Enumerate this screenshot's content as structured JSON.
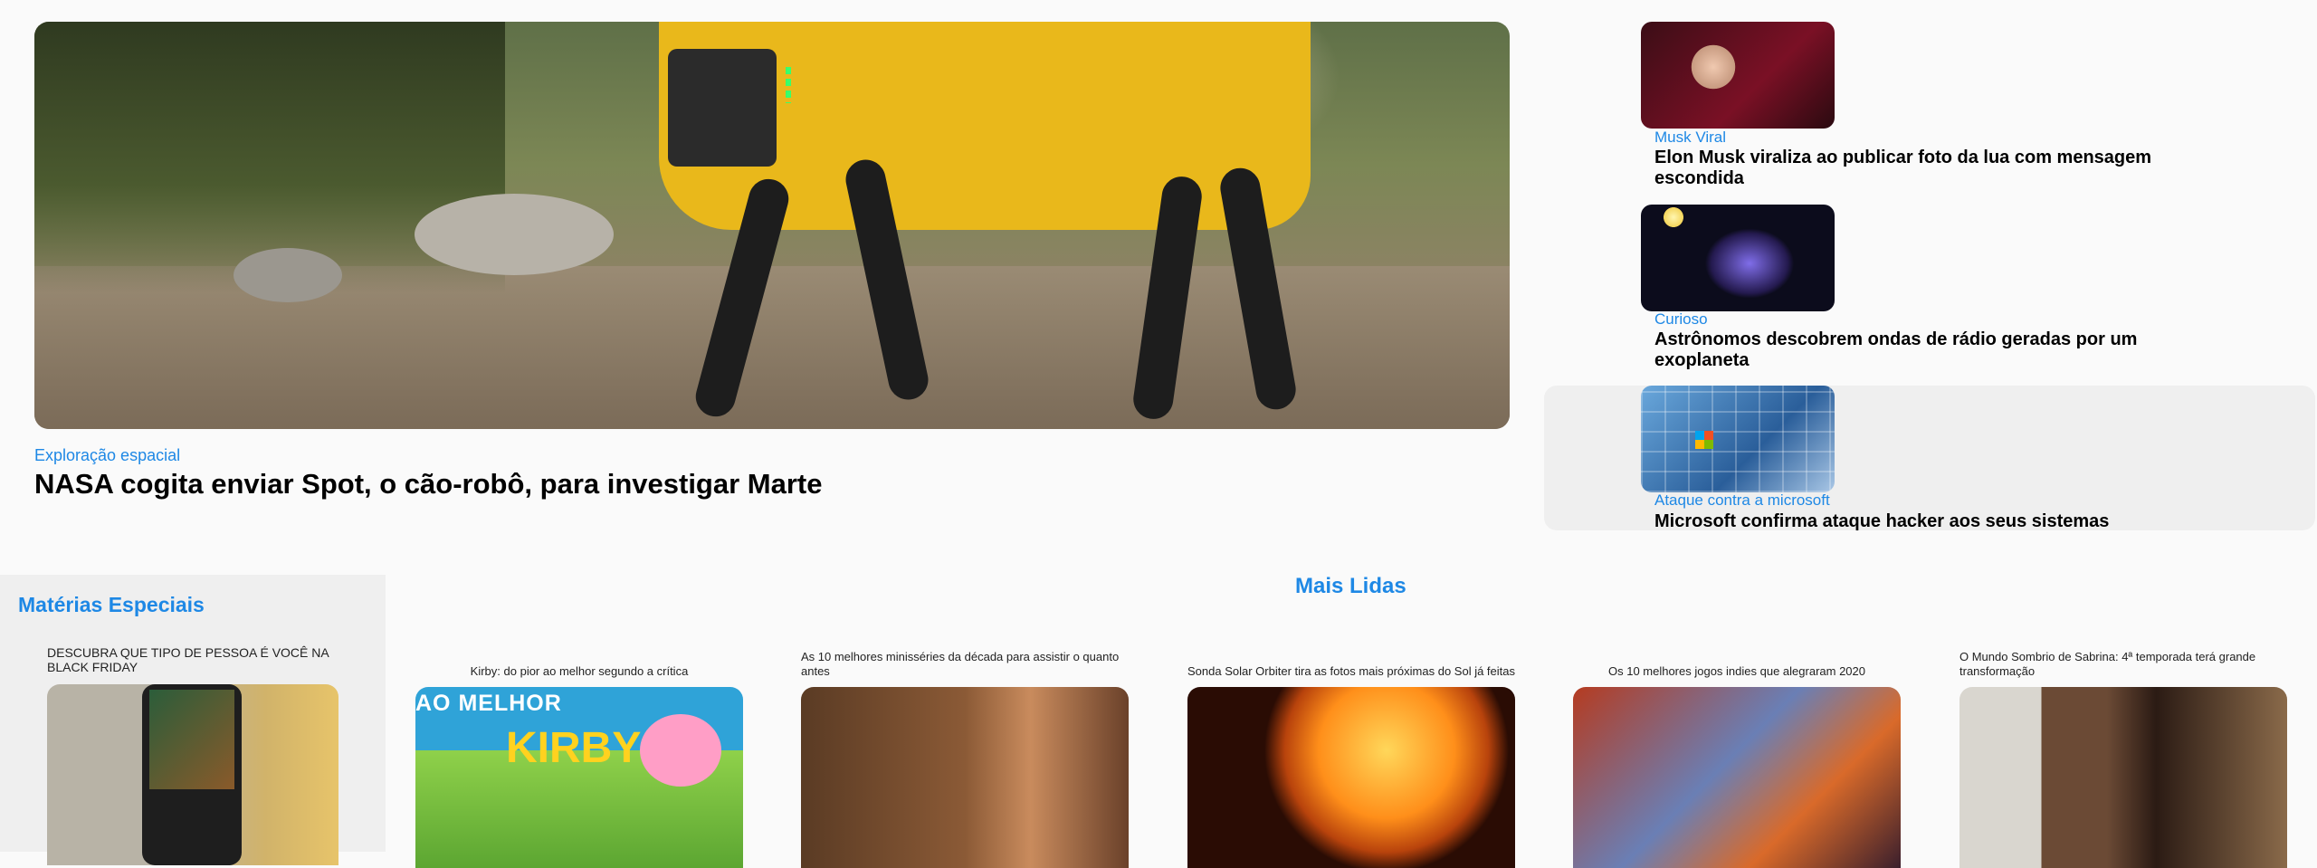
{
  "hero": {
    "category": "Exploração espacial",
    "title": "NASA cogita enviar Spot, o cão-robô, para investigar Marte"
  },
  "side": [
    {
      "category": "Musk Viral",
      "title": "Elon Musk viraliza ao publicar foto da lua com mensagem escondida"
    },
    {
      "category": "Curioso",
      "title": "Astrônomos descobrem ondas de rádio geradas por um exoplaneta"
    },
    {
      "category": "Ataque contra a microsoft",
      "title": "Microsoft confirma ataque hacker aos seus sistemas"
    }
  ],
  "especiais": {
    "heading": "Matérias Especiais",
    "caption": "DESCUBRA QUE TIPO DE PESSOA É VOCÊ NA BLACK FRIDAY"
  },
  "mais_lidas": {
    "heading": "Mais Lidas",
    "cards": [
      {
        "caption": "Kirby: do pior ao melhor segundo a crítica",
        "image_text": "AO MELHOR",
        "image_logo": "KIRBY"
      },
      {
        "caption": "As 10 melhores minisséries da década para assistir o quanto antes"
      },
      {
        "caption": "Sonda Solar Orbiter tira as fotos mais próximas do Sol já feitas"
      },
      {
        "caption": "Os 10 melhores jogos indies que alegraram 2020"
      },
      {
        "caption": "O Mundo Sombrio de Sabrina: 4ª temporada terá grande transformação"
      }
    ]
  },
  "colors": {
    "accent": "#1e88e5"
  }
}
